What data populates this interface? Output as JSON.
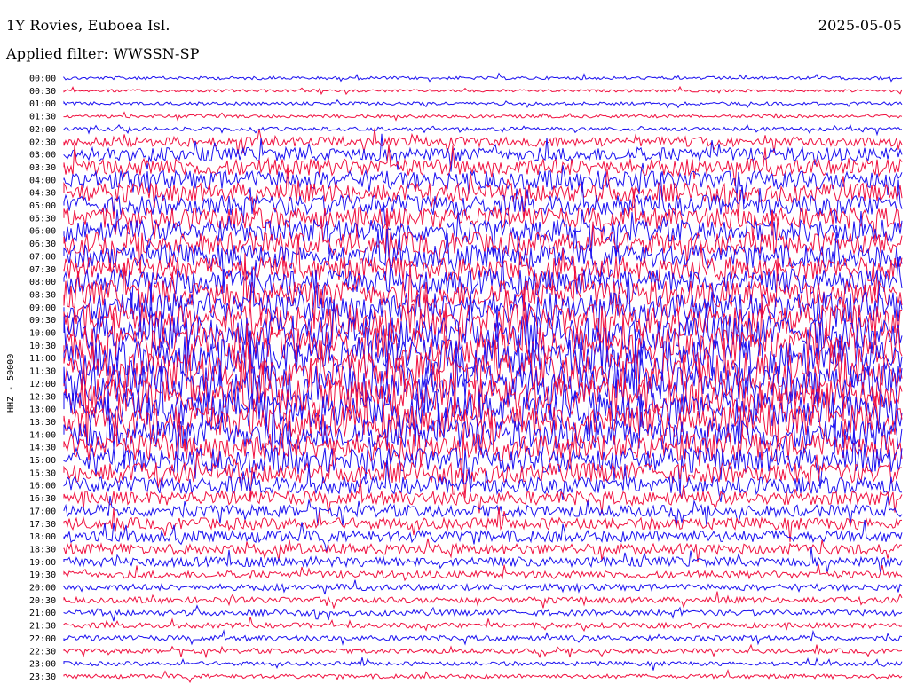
{
  "header": {
    "station": "1Y Rovies, Euboea Isl.",
    "date": "2025-05-05",
    "filter": "Applied filter: WWSSN-SP"
  },
  "chart_data": {
    "type": "helicorder",
    "ylabel": "HHZ - 50000",
    "row_labels": [
      "00:00",
      "00:30",
      "01:00",
      "01:30",
      "02:00",
      "02:30",
      "03:00",
      "03:30",
      "04:00",
      "04:30",
      "05:00",
      "05:30",
      "06:00",
      "06:30",
      "07:00",
      "07:30",
      "08:00",
      "08:30",
      "09:00",
      "09:30",
      "10:00",
      "10:30",
      "11:00",
      "11:30",
      "12:00",
      "12:30",
      "13:00",
      "13:30",
      "14:00",
      "14:30",
      "15:00",
      "15:30",
      "16:00",
      "16:30",
      "17:00",
      "17:30",
      "18:00",
      "18:30",
      "19:00",
      "19:30",
      "20:00",
      "20:30",
      "21:00",
      "21:30",
      "22:00",
      "22:30",
      "23:00",
      "23:30"
    ],
    "trace_colors": [
      "#1a0ff0",
      "#f0103f"
    ],
    "relative_amplitude": [
      0.3,
      0.25,
      0.3,
      0.3,
      0.35,
      0.9,
      1.3,
      1.6,
      1.7,
      1.8,
      1.9,
      2.0,
      2.1,
      2.1,
      2.2,
      2.3,
      2.4,
      2.6,
      2.8,
      3.0,
      3.2,
      3.4,
      3.5,
      3.5,
      3.5,
      3.4,
      3.3,
      3.1,
      2.9,
      2.6,
      2.3,
      1.9,
      1.6,
      1.3,
      1.1,
      1.1,
      1.1,
      1.0,
      0.9,
      0.7,
      0.6,
      0.55,
      0.55,
      0.5,
      0.5,
      0.45,
      0.4,
      0.4
    ]
  }
}
